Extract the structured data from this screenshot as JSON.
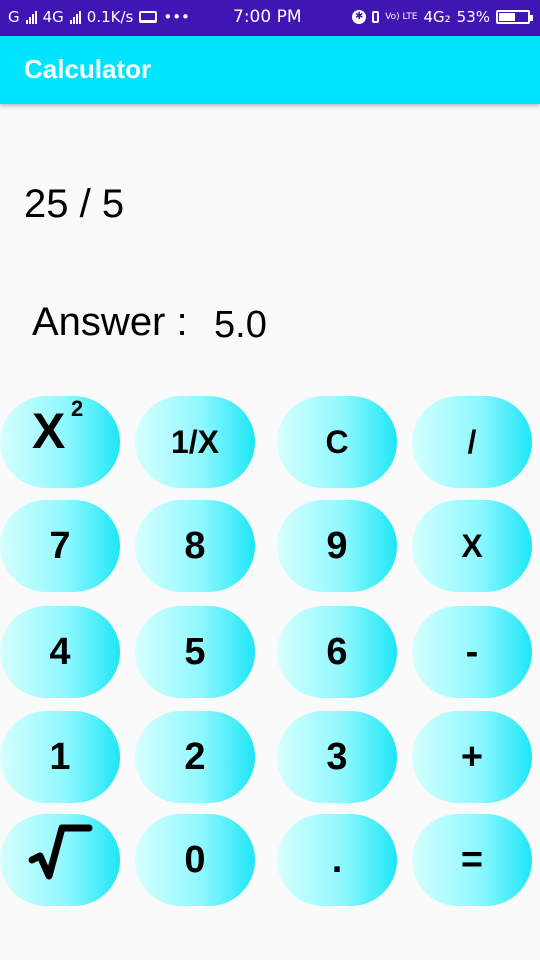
{
  "status_bar": {
    "carrier_left": "G",
    "network_1": "4G",
    "speed": "0.1K/s",
    "more": "•••",
    "time": "7:00 PM",
    "volte": "Vo) LTE",
    "network_2": "4G₂",
    "battery": "53%"
  },
  "app_bar": {
    "title": "Calculator"
  },
  "display": {
    "expression": "25 / 5",
    "answer_label": "Answer :",
    "answer_value": "5.0"
  },
  "keys": {
    "square": "X²",
    "reciprocal": "1/X",
    "clear": "C",
    "divide": "/",
    "seven": "7",
    "eight": "8",
    "nine": "9",
    "multiply": "X",
    "four": "4",
    "five": "5",
    "six": "6",
    "minus": "-",
    "one": "1",
    "two": "2",
    "three": "3",
    "plus": "+",
    "sqrt": "√",
    "zero": "0",
    "dot": ".",
    "equals": "="
  },
  "icons": {
    "square_key": "x-squared-icon",
    "sqrt_key": "square-root-icon",
    "bluetooth": "bluetooth-icon",
    "vibrate": "vibrate-icon",
    "battery": "battery-icon",
    "screen_cast": "laptop-icon",
    "signal": "signal-icon"
  },
  "colors": {
    "status_bar": "#3f16b4",
    "app_bar": "#00e5ff",
    "key_light": "#d6ffff",
    "key_dark": "#1ee6f6",
    "background": "#fafafa"
  }
}
